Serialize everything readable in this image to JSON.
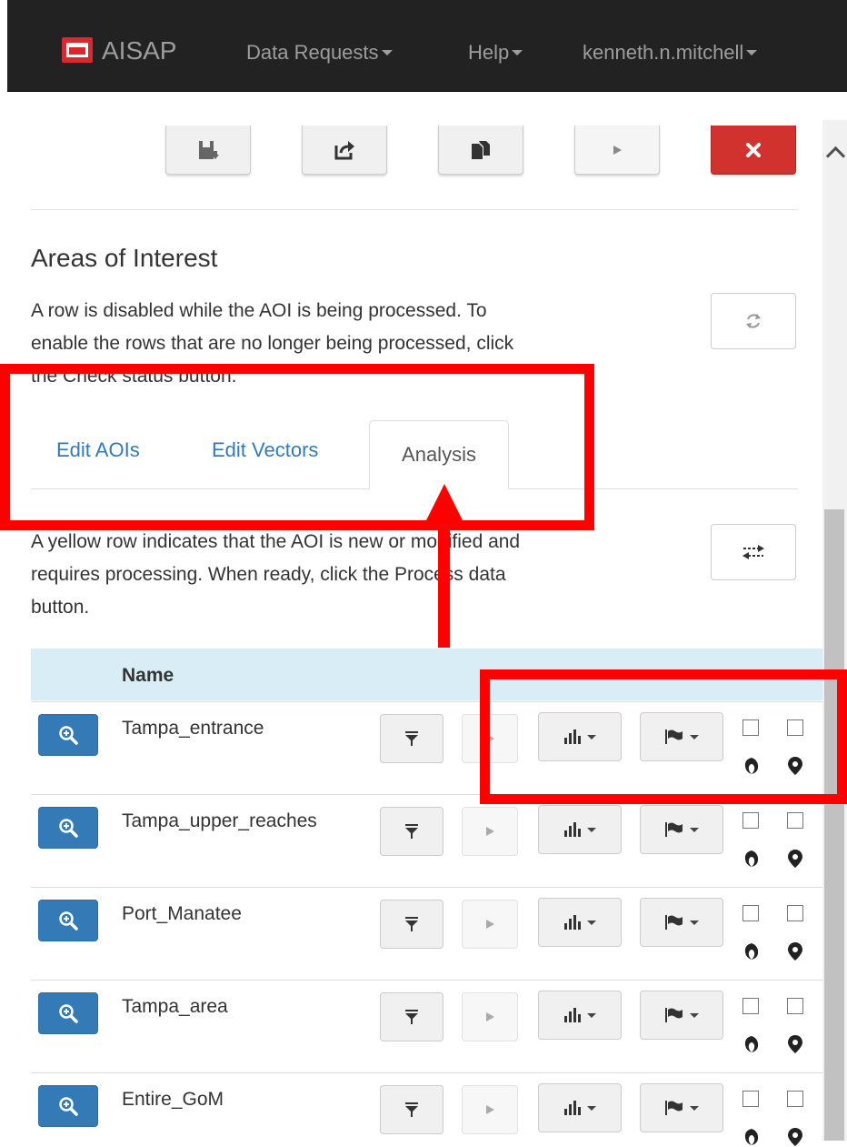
{
  "navbar": {
    "brand": "AISAP",
    "menus": [
      "Data Requests",
      "Help",
      "kenneth.n.mitchell"
    ]
  },
  "section": {
    "title": "Areas of Interest",
    "description_line1": "A row is disabled while the AOI is being processed. To",
    "description_line2": "enable the rows that are no longer being processed, click",
    "description_line3": "the Check status button."
  },
  "tabs": [
    "Edit AOIs",
    "Edit Vectors",
    "Analysis"
  ],
  "active_tab": "Analysis",
  "process_note": {
    "line1": "A yellow row indicates that the AOI is new or modified and",
    "line2": "requires processing. When ready, click the Process data",
    "line3": "button."
  },
  "table": {
    "header_name": "Name",
    "rows": [
      {
        "name": "Tampa_entrance"
      },
      {
        "name": "Tampa_upper_reaches"
      },
      {
        "name": "Port_Manatee"
      },
      {
        "name": "Tampa_area"
      },
      {
        "name": "Entire_GoM"
      }
    ]
  },
  "colors": {
    "navbar": "#222222",
    "primary": "#337ab7",
    "danger": "#d2322d",
    "table_header": "#d9edf7",
    "annotation": "#ff0000"
  }
}
